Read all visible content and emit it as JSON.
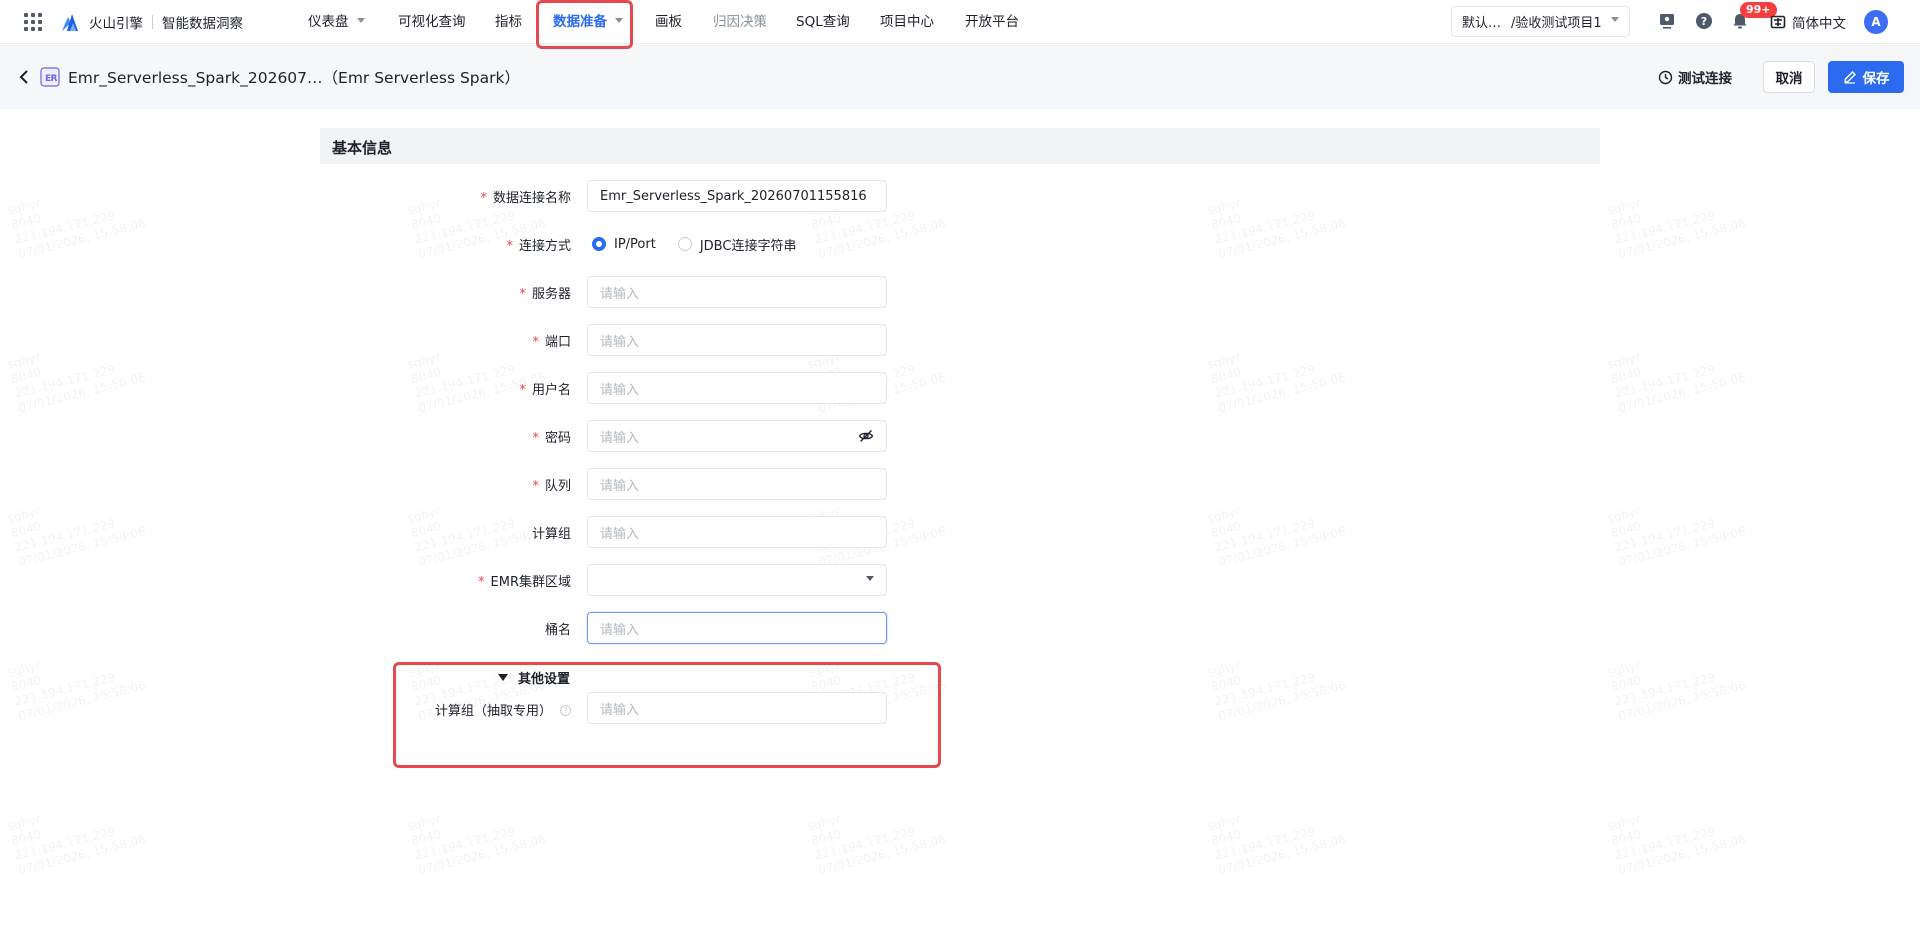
{
  "brand": {
    "name": "火山引擎",
    "product": "智能数据洞察"
  },
  "nav": {
    "items": [
      {
        "label": "仪表盘",
        "has_caret": true
      },
      {
        "label": "可视化查询"
      },
      {
        "label": "指标"
      },
      {
        "label": "数据准备",
        "has_caret": true,
        "active": true
      },
      {
        "label": "画板"
      },
      {
        "label": "归因决策",
        "disabled": true
      },
      {
        "label": "SQL查询"
      },
      {
        "label": "项目中心"
      },
      {
        "label": "开放平台"
      }
    ]
  },
  "project_select": {
    "part1": "默认…",
    "part2": "/验收测试项目1"
  },
  "notifications": {
    "badge": "99+"
  },
  "language": "简体中文",
  "avatar": "A",
  "header": {
    "title": "Emr_Serverless_Spark_202607…（Emr Serverless Spark）",
    "test_connection": "测试连接",
    "cancel": "取消",
    "save": "保存"
  },
  "section": {
    "title": "基本信息"
  },
  "form": {
    "connection_name": {
      "label": "数据连接名称",
      "required": "*",
      "value": "Emr_Serverless_Spark_20260701155816"
    },
    "connection_method": {
      "label": "连接方式",
      "required": "*",
      "options": [
        "IP/Port",
        "JDBC连接字符串"
      ],
      "selected": "IP/Port"
    },
    "server": {
      "label": "服务器",
      "required": "*",
      "placeholder": "请输入"
    },
    "port": {
      "label": "端口",
      "required": "*",
      "placeholder": "请输入"
    },
    "username": {
      "label": "用户名",
      "required": "*",
      "placeholder": "请输入"
    },
    "password": {
      "label": "密码",
      "required": "*",
      "placeholder": "请输入"
    },
    "queue": {
      "label": "队列",
      "required": "*",
      "placeholder": "请输入"
    },
    "compute_group": {
      "label": "计算组",
      "placeholder": "请输入"
    },
    "emr_region": {
      "label": "EMR集群区域",
      "required": "*",
      "value": ""
    },
    "bucket": {
      "label": "桶名",
      "placeholder": "请输入"
    }
  },
  "other_settings": {
    "title": "其他设置",
    "compute_group_extract": {
      "label": "计算组（抽取专用）",
      "placeholder": "请输入"
    }
  },
  "watermark": {
    "line1": "sqhyr",
    "line2": "8040",
    "line3": "221.194.171.229",
    "line4": "07/01/2026, 15:58:06"
  },
  "colors": {
    "accent": "#2c6bf0",
    "required": "#f53f3f",
    "highlight": "#e5484d"
  }
}
